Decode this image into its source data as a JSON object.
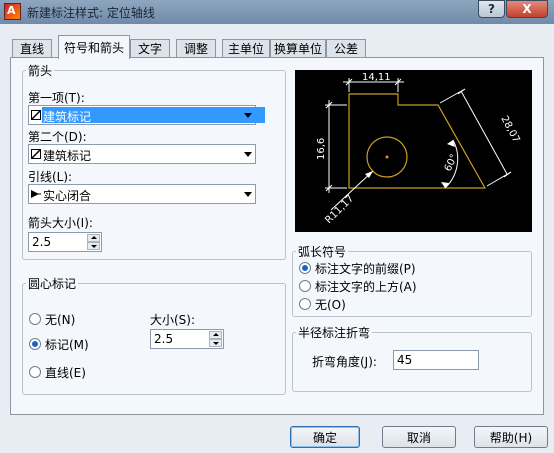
{
  "window": {
    "title": "新建标注样式: 定位轴线",
    "help_btn": "?",
    "close_btn": "X"
  },
  "tabs": [
    "直线",
    "符号和箭头",
    "文字",
    "调整",
    "主单位",
    "换算单位",
    "公差"
  ],
  "arrows": {
    "group_label": "箭头",
    "first_label": "第一项(T):",
    "first_value": "建筑标记",
    "second_label": "第二个(D):",
    "second_value": "建筑标记",
    "leader_label": "引线(L):",
    "leader_value": "实心闭合",
    "size_label": "箭头大小(I):",
    "size_value": "2.5"
  },
  "center_marks": {
    "group_label": "圆心标记",
    "options": [
      "无(N)",
      "标记(M)",
      "直线(E)"
    ],
    "selected": "标记(M)",
    "size_label": "大小(S):",
    "size_value": "2.5"
  },
  "arc_length": {
    "group_label": "弧长符号",
    "options": [
      "标注文字的前缀(P)",
      "标注文字的上方(A)",
      "无(O)"
    ],
    "selected": "标注文字的前缀(P)"
  },
  "radius_jog": {
    "group_label": "半径标注折弯",
    "angle_label": "折弯角度(J):",
    "angle_value": "45"
  },
  "preview": {
    "dim_top": "14,11",
    "dim_left": "16,6",
    "dim_right": "28,07",
    "dim_angle": "60°",
    "dim_radius": "R11,17"
  },
  "buttons": {
    "ok": "确定",
    "cancel": "取消",
    "help": "帮助(H)"
  },
  "colors": {
    "preview_bg": "#000000",
    "preview_dim": "#ffffff",
    "preview_shape": "#c8a020",
    "selection": "#3399ff"
  }
}
